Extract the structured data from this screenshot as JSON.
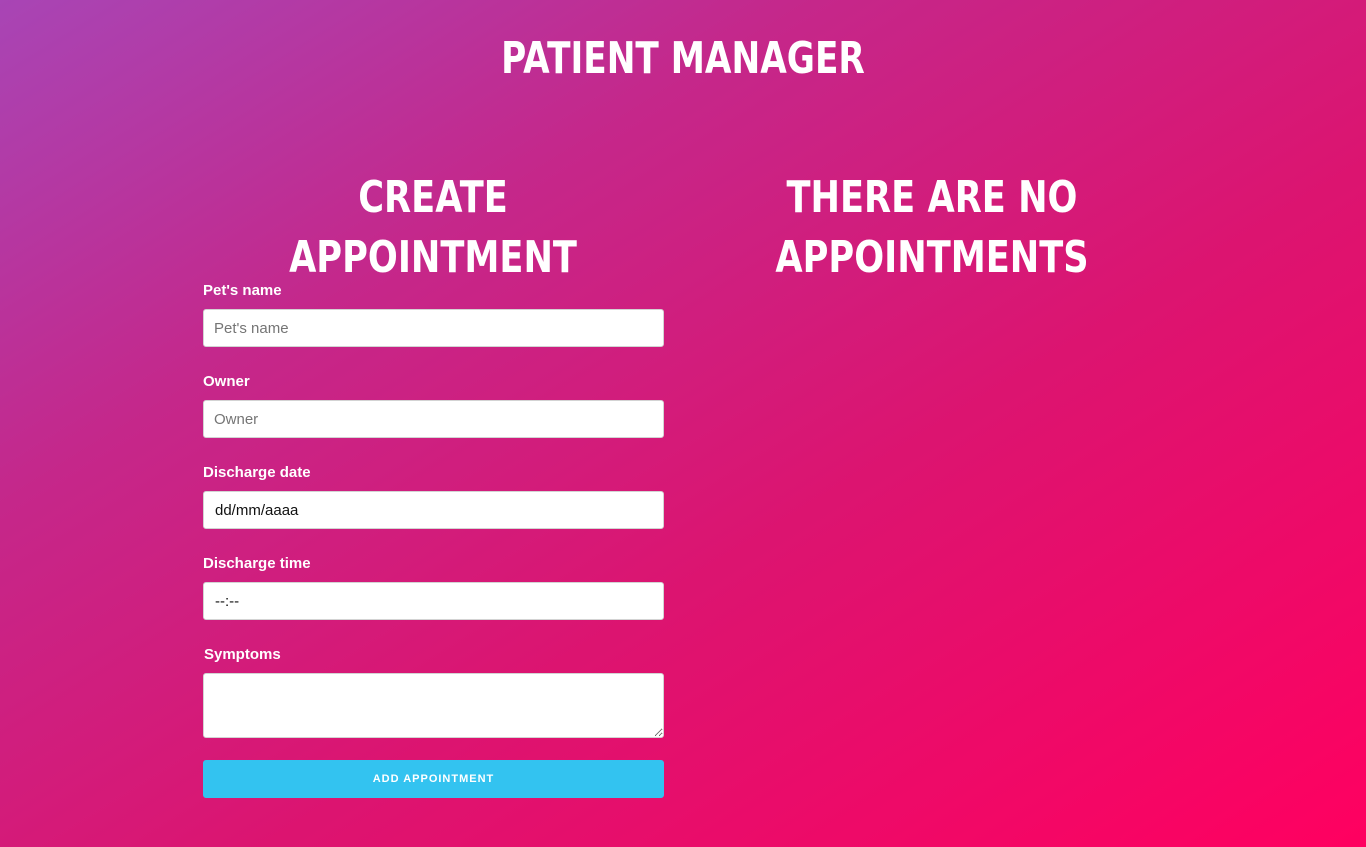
{
  "header": {
    "title": "PATIENT MANAGER"
  },
  "form": {
    "title": "CREATE APPOINTMENT",
    "fields": {
      "pet_name": {
        "label": "Pet's name",
        "placeholder": "Pet's name",
        "value": ""
      },
      "owner": {
        "label": "Owner",
        "placeholder": "Owner",
        "value": ""
      },
      "discharge_date": {
        "label": "Discharge date",
        "value": "dd/mm/aaaa"
      },
      "discharge_time": {
        "label": "Discharge time",
        "value": "--:--"
      },
      "symptoms": {
        "label": "Symptoms",
        "value": ""
      }
    },
    "submit_label": "ADD APPOINTMENT"
  },
  "appointments": {
    "empty_title": "THERE ARE NO APPOINTMENTS"
  },
  "colors": {
    "gradient_start": "#a845b5",
    "gradient_end": "#ff0060",
    "button": "#33c3f0"
  }
}
